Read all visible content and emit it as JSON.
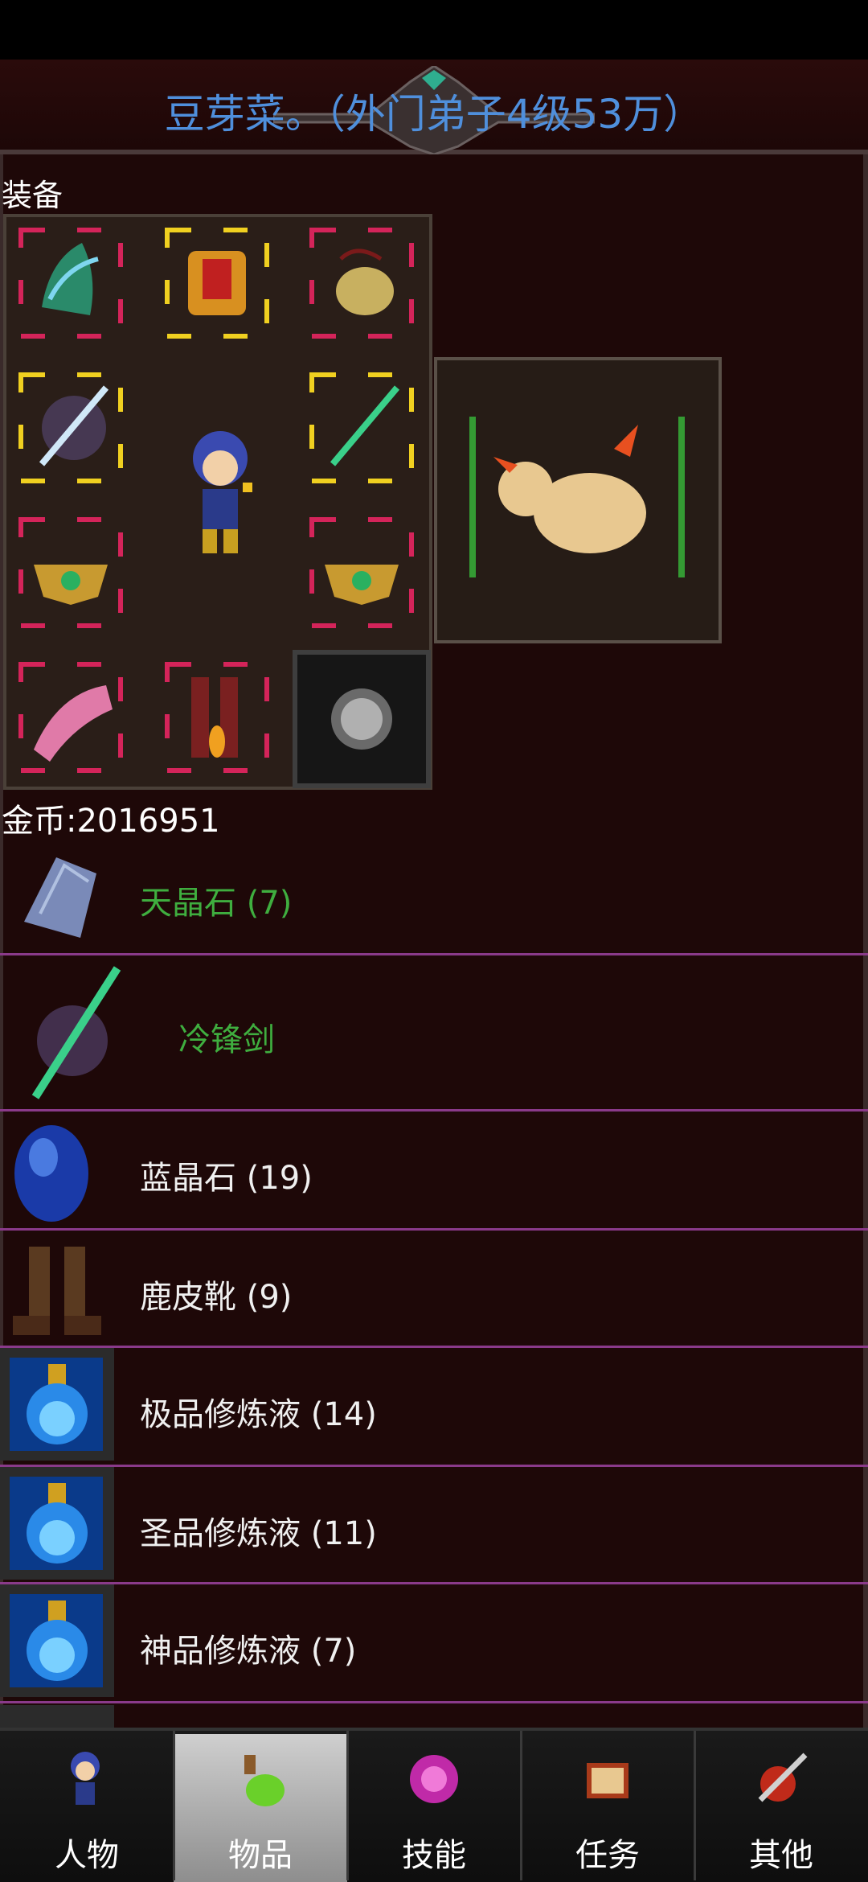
{
  "header": {
    "title": "豆芽菜。（外门弟子4级53万）"
  },
  "equipment": {
    "section_label": "装备"
  },
  "gold": {
    "label": "金币:2016951"
  },
  "items": [
    {
      "name": "天晶石 (7)",
      "icon": "crystal-icon",
      "color": "#3fae3f"
    },
    {
      "name": "冷锋剑",
      "icon": "green-sword-icon",
      "color": "#3fae3f"
    },
    {
      "name": "蓝晶石 (19)",
      "icon": "blue-gem-icon",
      "color": "#f0f0f0"
    },
    {
      "name": "鹿皮靴 (9)",
      "icon": "boots-icon",
      "color": "#f0f0f0"
    },
    {
      "name": "极品修炼液 (14)",
      "icon": "blue-potion-icon",
      "color": "#f0f0f0"
    },
    {
      "name": "圣品修炼液 (11)",
      "icon": "blue-potion-icon",
      "color": "#f0f0f0"
    },
    {
      "name": "神品修炼液 (7)",
      "icon": "blue-potion-icon",
      "color": "#f0f0f0"
    }
  ],
  "nav": {
    "tabs": [
      {
        "label": "人物",
        "icon": "character-icon"
      },
      {
        "label": "物品",
        "icon": "potion-bag-icon",
        "active": true
      },
      {
        "label": "技能",
        "icon": "skill-orb-icon"
      },
      {
        "label": "任务",
        "icon": "quest-book-icon"
      },
      {
        "label": "其他",
        "icon": "sword-shield-icon"
      }
    ]
  },
  "colors": {
    "title_blue": "#4f8fdc",
    "item_green": "#3fae3f",
    "divider_purple": "#8a3a8a",
    "background": "#1e0808"
  }
}
